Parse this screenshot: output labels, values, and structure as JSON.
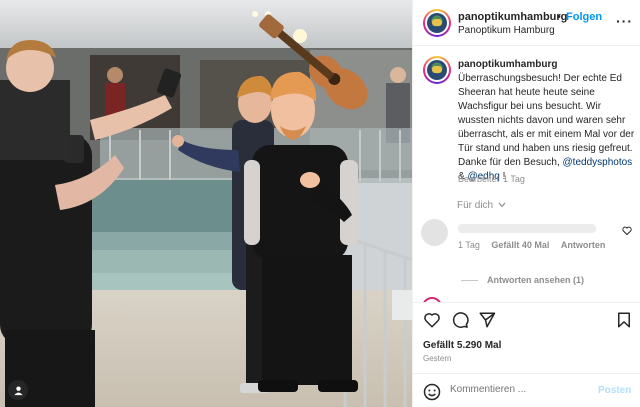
{
  "header": {
    "username": "panoptikumhamburg",
    "separator": "•",
    "follow_label": "Folgen",
    "location": "Panoptikum Hamburg",
    "more_icon": "more-icon"
  },
  "caption": {
    "username": "panoptikumhamburg",
    "text": "Überraschungsbesuch! Der echte Ed Sheeran hat heute heute seine Wachsfigur bei uns besucht. Wir wussten nichts davon und waren sehr überrascht, als er mit einem Mal vor der Tür stand und haben uns riesig gefreut. Danke für den Besuch, ",
    "tag1": "@teddysphotos",
    "between": " & ",
    "tag2": "@edhq",
    "end": " !",
    "edited": "Bearbeitet",
    "age": "1 Tag"
  },
  "for_you": "Für dich",
  "comment": {
    "age": "1 Tag",
    "likes": "Gefällt 40 Mal",
    "reply": "Antworten"
  },
  "view_replies": "Antworten ansehen (1)",
  "footer": {
    "likes": "Gefällt 5.290 Mal",
    "date": "Gestern",
    "comment_placeholder": "Kommentieren ...",
    "post_label": "Posten"
  },
  "colors": {
    "link_blue": "#0095f6",
    "tag_blue": "#00376b",
    "muted": "#8e8e8e"
  }
}
